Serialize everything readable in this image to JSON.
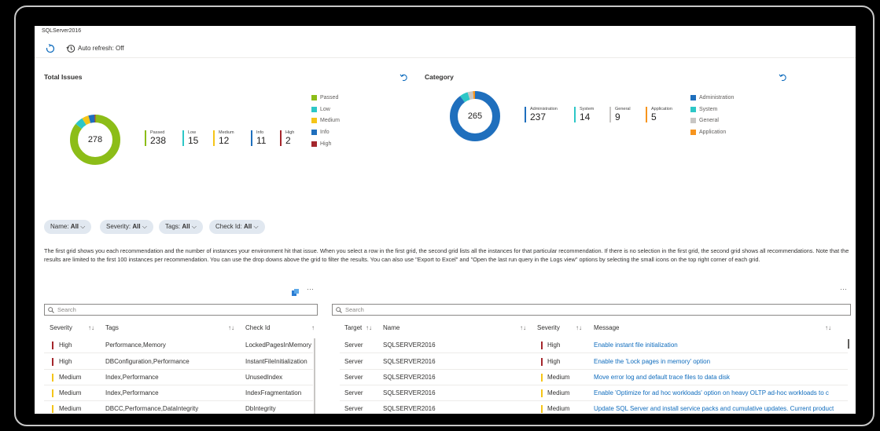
{
  "window": {
    "title": "SQLServer2016"
  },
  "toolbar": {
    "auto_refresh": "Auto refresh: Off"
  },
  "total_issues": {
    "title": "Total Issues",
    "total": "278",
    "stats": [
      {
        "label": "Passed",
        "value": "238",
        "color": "#8cbd18"
      },
      {
        "label": "Low",
        "value": "15",
        "color": "#2dc7c7"
      },
      {
        "label": "Medium",
        "value": "12",
        "color": "#f5c518"
      },
      {
        "label": "Info",
        "value": "11",
        "color": "#1f6fbd"
      },
      {
        "label": "High",
        "value": "2",
        "color": "#a4262c"
      }
    ],
    "legend": [
      "Passed",
      "Low",
      "Medium",
      "Info",
      "High"
    ]
  },
  "category": {
    "title": "Category",
    "total": "265",
    "stats": [
      {
        "label": "Administration",
        "value": "237",
        "color": "#1f6fbd"
      },
      {
        "label": "System",
        "value": "14",
        "color": "#2dc7c7"
      },
      {
        "label": "General",
        "value": "9",
        "color": "#c8c6c4"
      },
      {
        "label": "Application",
        "value": "5",
        "color": "#f7941d"
      }
    ],
    "legend": [
      "Administration",
      "System",
      "General",
      "Application"
    ]
  },
  "filters": [
    {
      "label": "Name:",
      "value": "All"
    },
    {
      "label": "Severity:",
      "value": "All"
    },
    {
      "label": "Tags:",
      "value": "All"
    },
    {
      "label": "Check Id:",
      "value": "All"
    }
  ],
  "description": "The first grid shows you each recommendation and the number of instances your environment hit that issue. When you select a row in the first grid, the second grid lists all the instances for that particular recommendation. If there is no selection in the first grid, the second grid shows all recommendations. Note that the results are limited to the first 100 instances per recommendation. You can use the drop downs above the grid to filter the results. You can also use \"Export to Excel\" and \"Open the last run query in the Logs view\" options by selecting the small icons on the top right corner of each grid.",
  "grid1": {
    "search_placeholder": "Search",
    "headers": [
      "Severity",
      "Tags",
      "Check Id"
    ],
    "rows": [
      {
        "severity": "High",
        "color": "#a4262c",
        "tags": "Performance,Memory",
        "check": "LockedPagesInMemory"
      },
      {
        "severity": "High",
        "color": "#a4262c",
        "tags": "DBConfiguration,Performance",
        "check": "InstantFileInitialization"
      },
      {
        "severity": "Medium",
        "color": "#f5c518",
        "tags": "Index,Performance",
        "check": "UnusedIndex"
      },
      {
        "severity": "Medium",
        "color": "#f5c518",
        "tags": "Index,Performance",
        "check": "IndexFragmentation"
      },
      {
        "severity": "Medium",
        "color": "#f5c518",
        "tags": "DBCC,Performance,DataIntegrity",
        "check": "DbIntegrity"
      }
    ]
  },
  "grid2": {
    "search_placeholder": "Search",
    "headers": [
      "Target",
      "Name",
      "Severity",
      "Message"
    ],
    "rows": [
      {
        "target": "Server",
        "name": "SQLSERVER2016",
        "severity": "High",
        "color": "#a4262c",
        "message": "Enable instant file initialization"
      },
      {
        "target": "Server",
        "name": "SQLSERVER2016",
        "severity": "High",
        "color": "#a4262c",
        "message": "Enable the 'Lock pages in memory' option"
      },
      {
        "target": "Server",
        "name": "SQLSERVER2016",
        "severity": "Medium",
        "color": "#f5c518",
        "message": "Move error log and default trace files to data disk"
      },
      {
        "target": "Server",
        "name": "SQLSERVER2016",
        "severity": "Medium",
        "color": "#f5c518",
        "message": "Enable 'Optimize for ad hoc workloads' option on heavy OLTP ad-hoc workloads to c"
      },
      {
        "target": "Server",
        "name": "SQLSERVER2016",
        "severity": "Medium",
        "color": "#f5c518",
        "message": "Update SQL Server and install service packs and cumulative updates. Current product"
      }
    ]
  },
  "more_glyph": "···",
  "sort_glyph": "↑↓",
  "sort_up_glyph": "↑"
}
